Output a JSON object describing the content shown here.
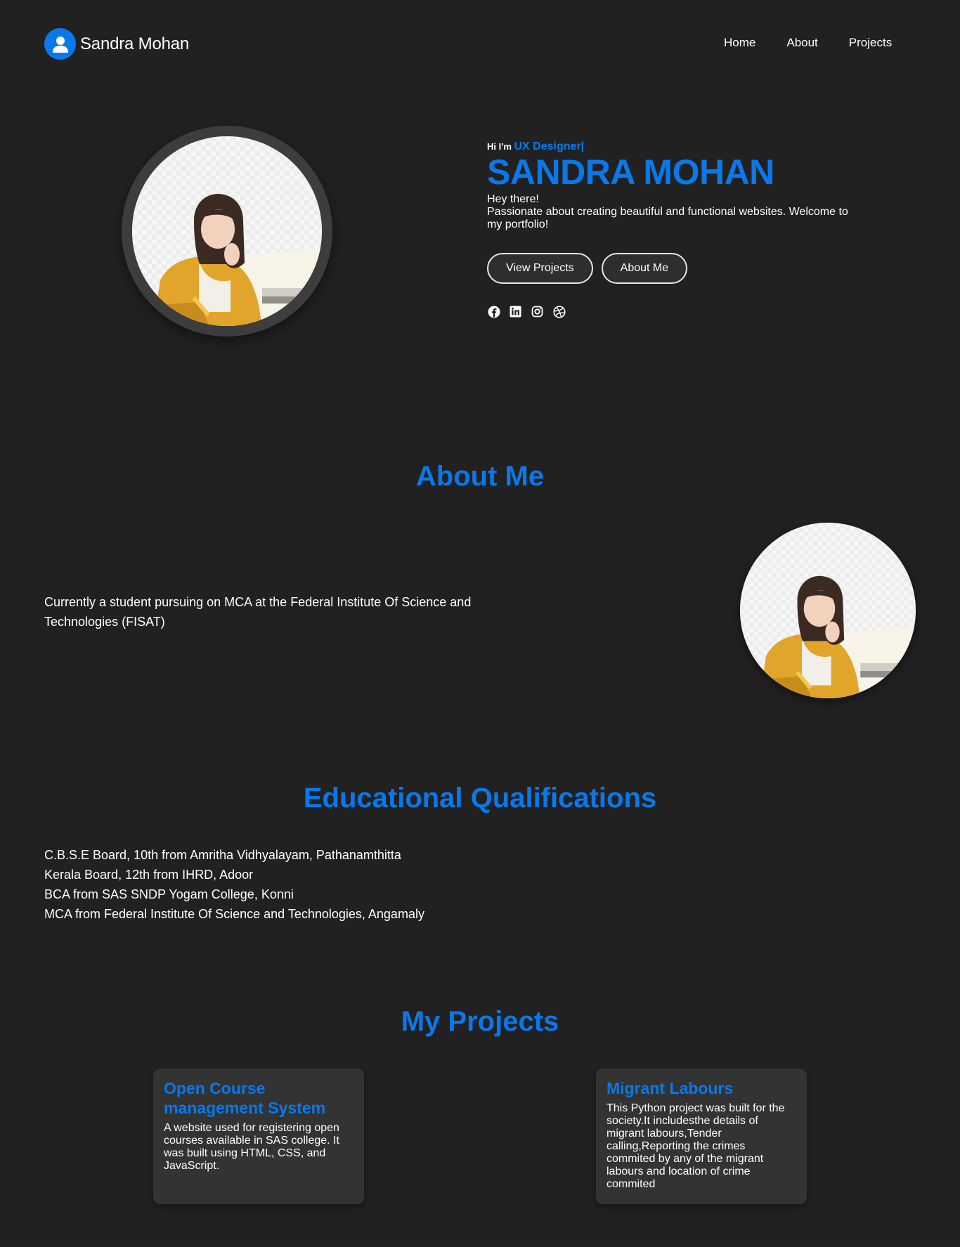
{
  "brand": {
    "name": "Sandra Mohan",
    "icon": "user-icon"
  },
  "nav": {
    "home": "Home",
    "about": "About",
    "projects": "Projects"
  },
  "hero": {
    "greeting": "Hi I'm",
    "role": "UX Designer|",
    "name": "SANDRA MOHAN",
    "line1": "Hey there!",
    "line2": "Passionate about creating beautiful and functional websites. Welcome to my portfolio!",
    "buttons": {
      "view_projects": "View Projects",
      "about_me": "About Me"
    },
    "socials": [
      "facebook-icon",
      "linkedin-icon",
      "instagram-icon",
      "dribbble-icon"
    ]
  },
  "about": {
    "title": "About Me",
    "text": "Currently a student pursuing on MCA at the Federal Institute Of Science and Technologies (FISAT)"
  },
  "education": {
    "title": "Educational Qualifications",
    "items": [
      "C.B.S.E Board, 10th from Amritha Vidhyalayam, Pathanamthitta",
      "Kerala Board, 12th from IHRD, Adoor",
      "BCA from SAS SNDP Yogam College, Konni",
      "MCA from Federal Institute Of Science and Technologies, Angamaly"
    ]
  },
  "projects": {
    "title": "My Projects",
    "items": [
      {
        "title": "Open Course management System",
        "desc": "A website used for registering open courses available in SAS college. It was built using HTML, CSS, and JavaScript."
      },
      {
        "title": "Migrant Labours",
        "desc": "This Python project was built for the society.It includesthe details of migrant labours,Tender calling,Reporting the crimes commited by any of the migrant labours and location of crime commited"
      }
    ]
  },
  "colors": {
    "accent": "#0a78ea",
    "background": "#212121",
    "card": "#333333"
  }
}
